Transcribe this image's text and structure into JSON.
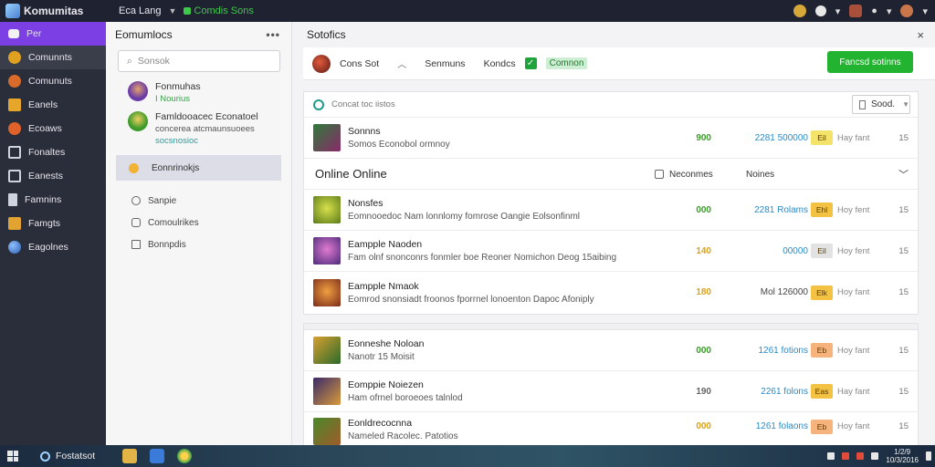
{
  "app": {
    "title": "Komumitas"
  },
  "topbar": {
    "menu_label": "Eca Lang",
    "status_label": "Comdis Sons",
    "icons": [
      "sticker-icon",
      "globe-icon",
      "chevron-down-icon",
      "avatar",
      "bell-icon",
      "settings-icon",
      "user-avatar"
    ]
  },
  "leftnav": {
    "items": [
      {
        "label": "Per",
        "icon": "home-icon",
        "color": "#f2f2f2"
      },
      {
        "label": "Comunnts",
        "icon": "communities-icon",
        "color": "#e0a020"
      },
      {
        "label": "Comunuts",
        "icon": "game-icon",
        "color": "#d86a2a"
      },
      {
        "label": "Eanels",
        "icon": "gift-icon",
        "color": "#e6a62a"
      },
      {
        "label": "Ecoaws",
        "icon": "smile-icon",
        "color": "#e0622a"
      },
      {
        "label": "Fonaltes",
        "icon": "window-icon",
        "color": "#cfd3e0"
      },
      {
        "label": "Eanests",
        "icon": "square-icon",
        "color": "#cfd3e0"
      },
      {
        "label": "Famnins",
        "icon": "flag-icon",
        "color": "#cfd3e0"
      },
      {
        "label": "Famgts",
        "icon": "trophy-icon",
        "color": "#e2a330"
      },
      {
        "label": "Eagolnes",
        "icon": "earth-icon",
        "color": "#3f83d6"
      }
    ]
  },
  "communities": {
    "title": "Eomumlocs",
    "more": "•••",
    "search_placeholder": "Sonsok",
    "items": [
      {
        "title": "Fonmuhas",
        "sub": "I Nourius",
        "color": "#6a3aa8"
      },
      {
        "title": "Famldooacec Econatoel",
        "sub": "concerea atcmaunsuoees",
        "sub2": "socsnosioc",
        "color": "#3c9a2a"
      }
    ],
    "selected": "Eonnrinokjs",
    "links": [
      {
        "label": "Sanpie",
        "icon": "user-icon"
      },
      {
        "label": "Comoulrikes",
        "icon": "chat-icon"
      },
      {
        "label": "Bonnpdis",
        "icon": "list-icon"
      }
    ]
  },
  "main": {
    "title": "Sotofics",
    "close": "×",
    "toolbar": {
      "user": "Cons Sot",
      "tab_a": "Senmuns",
      "tab_b": "Kondcs",
      "pill": "Comnon",
      "primary_button": "Fancsd sotinns"
    },
    "filter": {
      "label": "Concat toc iistos",
      "sort_label": "Sood."
    },
    "top_row": {
      "title": "Sonnns",
      "sub": "Somos Econobol ormnoy",
      "num": "900",
      "stat": "2281 500000",
      "badge": "Eil",
      "extra": "Hay fant",
      "end": "15",
      "badge_color": "#f4e36a",
      "num_class": "green",
      "thumb": "#2f7a3a"
    },
    "section": {
      "title": "Online Online",
      "col_a": "Neconmes",
      "col_b": "Noines"
    },
    "online_rows": [
      {
        "title": "Nonsfes",
        "sub": "Eomnooedoc Nam lonnlomy fomrose Oangie Eolsonfinml",
        "num": "000",
        "stat": "2281 Rolams",
        "badge": "Ehl",
        "extra": "Hoy fent",
        "end": "15",
        "badge_color": "#f3c242",
        "num_class": "green",
        "thumb": "#9bbf2a"
      },
      {
        "title": "Eampple Naoden",
        "sub": "Fam olnf snonconrs fonmler boe Reoner Nomichon Deog 15aibing",
        "num": "140",
        "stat": "00000",
        "badge": "Eil",
        "extra": "Hoy fent",
        "end": "15",
        "badge_color": "#e2e2e2",
        "num_class": "yellow",
        "thumb": "#6a3aa8"
      },
      {
        "title": "Eampple Nmaok",
        "sub": "Eomrod snonsiadt froonos fporrnel lonoenton Dapoc Afoniply",
        "num": "180",
        "stat": "Mol 126000",
        "badge": "Elk",
        "extra": "Hoy fant",
        "end": "15",
        "badge_color": "#f3c242",
        "num_class": "yellow",
        "thumb": "#b0452a"
      }
    ],
    "more_rows": [
      {
        "title": "Eonneshe Noloan",
        "sub": "Nanotr 15 Moisit",
        "num": "000",
        "stat": "1261 fotions",
        "badge": "Eb",
        "extra": "Hoy fant",
        "end": "15",
        "badge_color": "#f6b47c",
        "num_class": "green",
        "thumb": "#5a8a2a"
      },
      {
        "title": "Eomppie Noiezen",
        "sub": "Ham ofrnel boroeoes talnlod",
        "num": "190",
        "stat": "2261 folons",
        "badge": "Eas",
        "extra": "Hay fant",
        "end": "15",
        "badge_color": "#f3c242",
        "num_class": "gray",
        "thumb": "#3a2a6a"
      },
      {
        "title": "Eonldrecocnna",
        "sub": "Nameled Racolec. Patotios",
        "num": "000",
        "stat": "1261 folaons",
        "badge": "Eb",
        "extra": "Hoy fant",
        "end": "15",
        "badge_color": "#f6b47c",
        "num_class": "yellow",
        "thumb": "#4a8a2a"
      }
    ]
  },
  "taskbar": {
    "search_label": "Fostatsot",
    "time": "1/2/9",
    "date": "10/3/2016",
    "apps": [
      "folder-icon",
      "store-icon",
      "browser-icon"
    ]
  }
}
